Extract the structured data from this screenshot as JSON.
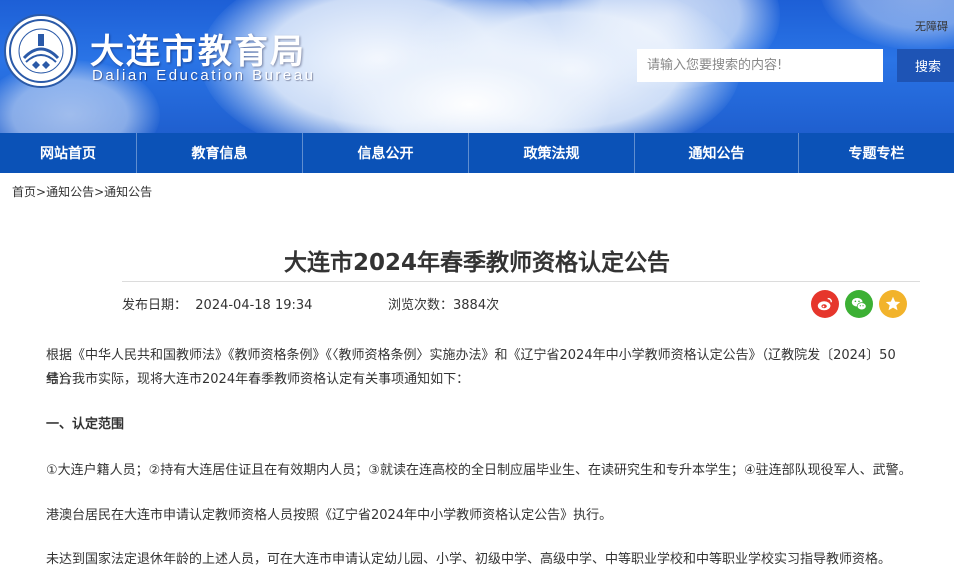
{
  "header": {
    "site_title": "大连市教育局",
    "site_subtitle": "Dalian Education Bureau",
    "corner_link": "无障碍",
    "search": {
      "placeholder": "请输入您要搜索的内容!",
      "button_label": "搜索"
    }
  },
  "nav": {
    "items": [
      {
        "label": "网站首页"
      },
      {
        "label": "教育信息"
      },
      {
        "label": "信息公开"
      },
      {
        "label": "政策法规"
      },
      {
        "label": "通知公告"
      },
      {
        "label": "专题专栏"
      }
    ]
  },
  "breadcrumb": {
    "items": [
      "首页",
      "通知公告",
      "通知公告"
    ],
    "sep": ">"
  },
  "article": {
    "title": "大连市2024年春季教师资格认定公告",
    "date_label": "发布日期：",
    "date_value": "2024-04-18 19:34",
    "views_label": "浏览次数：",
    "views_value": "3884次",
    "paragraphs": {
      "p1_line1": "根据《中华人民共和国教师法》《教师资格条例》《〈教师资格条例〉实施办法》和《辽宁省2024年中小学教师资格认定公告》（辽教院发〔2024〕50号），",
      "p1_line2": "结合我市实际，现将大连市2024年春季教师资格认定有关事项通知如下：",
      "section1_heading": "一、认定范围",
      "p2": "①大连户籍人员；②持有大连居住证且在有效期内人员；③就读在连高校的全日制应届毕业生、在读研究生和专升本学生；④驻连部队现役军人、武警。",
      "p3": "港澳台居民在大连市申请认定教师资格人员按照《辽宁省2024年中小学教师资格认定公告》执行。",
      "p4": "未达到国家法定退休年龄的上述人员，可在大连市申请认定幼儿园、小学、初级中学、高级中学、中等职业学校和中等职业学校实习指导教师资格。"
    }
  },
  "share": {
    "weibo_icon": "weibo-icon",
    "wechat_icon": "wechat-icon",
    "favorite_icon": "star-icon",
    "colors": {
      "weibo": "#e6362c",
      "wechat": "#3cb034",
      "favorite": "#f2b32b"
    }
  },
  "colors": {
    "nav_bg": "#0b52b7",
    "search_btn": "#1e54b5"
  }
}
